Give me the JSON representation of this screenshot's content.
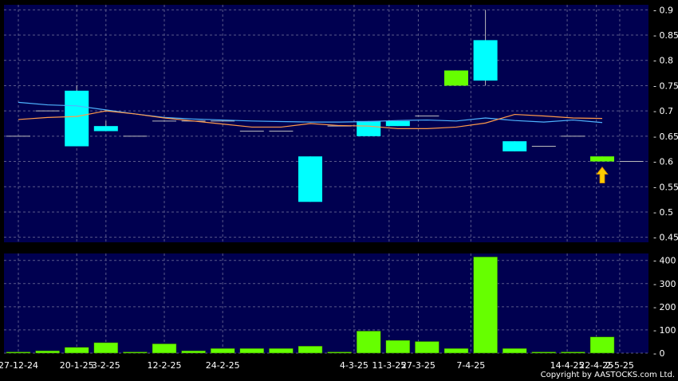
{
  "chart_data": [
    {
      "type": "candlestick",
      "ylim": [
        0.44,
        0.91
      ],
      "yticks": [
        0.45,
        0.5,
        0.55,
        0.6,
        0.65,
        0.7,
        0.75,
        0.8,
        0.85,
        0.9
      ],
      "ytick_labels": [
        "0.45",
        "0.5",
        "0.55",
        "0.6",
        "0.65",
        "0.7",
        "0.75",
        "0.8",
        "0.85",
        "0.9"
      ],
      "grid": true,
      "up_color": "#00ffff",
      "down_color": "#66ff00",
      "candles": [
        {
          "o": 0.65,
          "h": 0.65,
          "l": 0.65,
          "c": 0.65
        },
        {
          "o": 0.7,
          "h": 0.7,
          "l": 0.7,
          "c": 0.7
        },
        {
          "o": 0.63,
          "h": 0.75,
          "l": 0.63,
          "c": 0.74
        },
        {
          "o": 0.66,
          "h": 0.68,
          "l": 0.66,
          "c": 0.67
        },
        {
          "o": 0.65,
          "h": 0.65,
          "l": 0.65,
          "c": 0.65
        },
        {
          "o": 0.68,
          "h": 0.68,
          "l": 0.68,
          "c": 0.68
        },
        {
          "o": 0.68,
          "h": 0.68,
          "l": 0.68,
          "c": 0.68
        },
        {
          "o": 0.68,
          "h": 0.68,
          "l": 0.68,
          "c": 0.68
        },
        {
          "o": 0.66,
          "h": 0.66,
          "l": 0.66,
          "c": 0.66
        },
        {
          "o": 0.66,
          "h": 0.66,
          "l": 0.66,
          "c": 0.66
        },
        {
          "o": 0.52,
          "h": 0.61,
          "l": 0.52,
          "c": 0.61
        },
        {
          "o": 0.67,
          "h": 0.67,
          "l": 0.67,
          "c": 0.67
        },
        {
          "o": 0.65,
          "h": 0.68,
          "l": 0.65,
          "c": 0.68
        },
        {
          "o": 0.67,
          "h": 0.68,
          "l": 0.67,
          "c": 0.68
        },
        {
          "o": 0.69,
          "h": 0.69,
          "l": 0.69,
          "c": 0.69
        },
        {
          "o": 0.78,
          "h": 0.78,
          "l": 0.75,
          "c": 0.75
        },
        {
          "o": 0.76,
          "h": 0.9,
          "l": 0.75,
          "c": 0.84
        },
        {
          "o": 0.62,
          "h": 0.64,
          "l": 0.62,
          "c": 0.64
        },
        {
          "o": 0.63,
          "h": 0.63,
          "l": 0.63,
          "c": 0.63
        },
        {
          "o": 0.65,
          "h": 0.65,
          "l": 0.65,
          "c": 0.65
        },
        {
          "o": 0.61,
          "h": 0.61,
          "l": 0.6,
          "c": 0.6
        },
        {
          "o": 0.6,
          "h": 0.6,
          "l": 0.6,
          "c": 0.6
        }
      ],
      "moving_averages": [
        {
          "color": "#4fb4ff",
          "values": [
            0.717,
            0.712,
            0.71,
            0.702,
            0.694,
            0.687,
            0.684,
            0.682,
            0.68,
            0.679,
            0.678,
            0.678,
            0.679,
            0.681,
            0.682,
            0.68,
            0.686,
            0.681,
            0.678,
            0.682,
            0.677
          ]
        },
        {
          "color": "#ff9a4a",
          "values": [
            0.683,
            0.687,
            0.689,
            0.7,
            0.694,
            0.686,
            0.68,
            0.674,
            0.668,
            0.668,
            0.675,
            0.671,
            0.67,
            0.665,
            0.665,
            0.668,
            0.676,
            0.693,
            0.69,
            0.686,
            0.685
          ]
        }
      ],
      "marker": {
        "type": "arrow-up",
        "color": "#ffcc00",
        "index": 20,
        "value": 0.57
      }
    },
    {
      "type": "bar",
      "ylim": [
        0,
        430
      ],
      "yticks": [
        0,
        100,
        200,
        300,
        400
      ],
      "ytick_labels": [
        "0",
        "100",
        "200",
        "300",
        "400"
      ],
      "grid": true,
      "bar_color": "#66ff00",
      "values": [
        5,
        10,
        25,
        45,
        5,
        40,
        10,
        20,
        20,
        20,
        30,
        5,
        95,
        55,
        50,
        20,
        415,
        20,
        5,
        5,
        70,
        0
      ]
    }
  ],
  "x_labels": [
    {
      "index": 0,
      "label": "27-12-24"
    },
    {
      "index": 2,
      "label": "20-1-25"
    },
    {
      "index": 3,
      "label": "3-2-25"
    },
    {
      "index": 5,
      "label": "12-2-25"
    },
    {
      "index": 7,
      "label": "24-2-25"
    },
    {
      "index": 11.5,
      "label": "4-3-25"
    },
    {
      "index": 12.7,
      "label": "11-3-25"
    },
    {
      "index": 13.7,
      "label": "27-3-25"
    },
    {
      "index": 15.5,
      "label": "7-4-25"
    },
    {
      "index": 18.8,
      "label": "14-4-25"
    },
    {
      "index": 19.8,
      "label": "22-4-25"
    },
    {
      "index": 20.6,
      "label": "2-5-25"
    }
  ],
  "copyright": "Copyright by AASTOCKS.com Ltd."
}
